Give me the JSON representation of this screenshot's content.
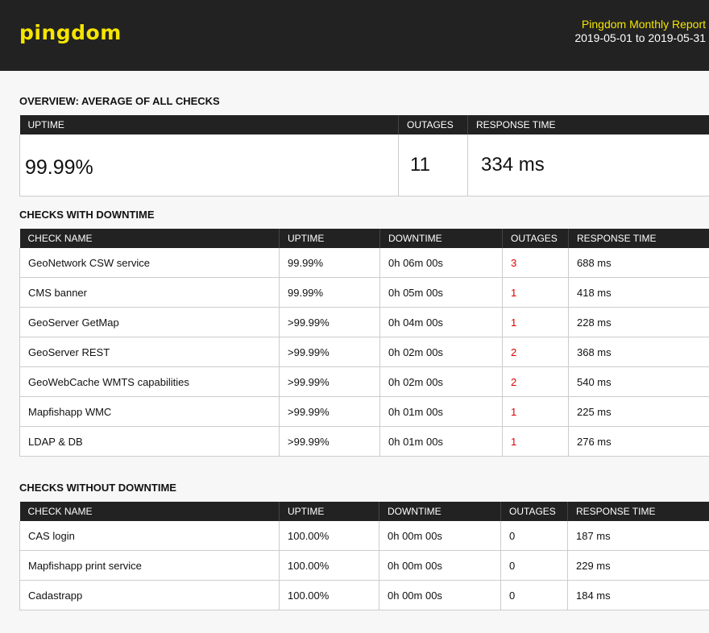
{
  "header": {
    "logo": "pingdom",
    "report_title": "Pingdom Monthly Report",
    "date_range": "2019-05-01 to 2019-05-31"
  },
  "overview": {
    "title": "OVERVIEW: AVERAGE OF ALL CHECKS",
    "columns": [
      "UPTIME",
      "OUTAGES",
      "RESPONSE TIME"
    ],
    "uptime": "99.99%",
    "outages": "11",
    "response_time": "334 ms"
  },
  "with_downtime": {
    "title": "CHECKS WITH DOWNTIME",
    "columns": [
      "CHECK NAME",
      "UPTIME",
      "DOWNTIME",
      "OUTAGES",
      "RESPONSE TIME"
    ],
    "rows": [
      {
        "name": "GeoNetwork CSW service",
        "uptime": "99.99%",
        "downtime": "0h 06m 00s",
        "outages": "3",
        "response": "688 ms"
      },
      {
        "name": "CMS banner",
        "uptime": "99.99%",
        "downtime": "0h 05m 00s",
        "outages": "1",
        "response": "418 ms"
      },
      {
        "name": "GeoServer GetMap",
        "uptime": ">99.99%",
        "downtime": "0h 04m 00s",
        "outages": "1",
        "response": "228 ms"
      },
      {
        "name": "GeoServer REST",
        "uptime": ">99.99%",
        "downtime": "0h 02m 00s",
        "outages": "2",
        "response": "368 ms"
      },
      {
        "name": "GeoWebCache WMTS capabilities",
        "uptime": ">99.99%",
        "downtime": "0h 02m 00s",
        "outages": "2",
        "response": "540 ms"
      },
      {
        "name": "Mapfishapp WMC",
        "uptime": ">99.99%",
        "downtime": "0h 01m 00s",
        "outages": "1",
        "response": "225 ms"
      },
      {
        "name": "LDAP & DB",
        "uptime": ">99.99%",
        "downtime": "0h 01m 00s",
        "outages": "1",
        "response": "276 ms"
      }
    ]
  },
  "without_downtime": {
    "title": "CHECKS WITHOUT DOWNTIME",
    "columns": [
      "CHECK NAME",
      "UPTIME",
      "DOWNTIME",
      "OUTAGES",
      "RESPONSE TIME"
    ],
    "rows": [
      {
        "name": "CAS login",
        "uptime": "100.00%",
        "downtime": "0h 00m 00s",
        "outages": "0",
        "response": "187 ms"
      },
      {
        "name": "Mapfishapp print service",
        "uptime": "100.00%",
        "downtime": "0h 00m 00s",
        "outages": "0",
        "response": "229 ms"
      },
      {
        "name": "Cadastrapp",
        "uptime": "100.00%",
        "downtime": "0h 00m 00s",
        "outages": "0",
        "response": "184 ms"
      }
    ]
  }
}
